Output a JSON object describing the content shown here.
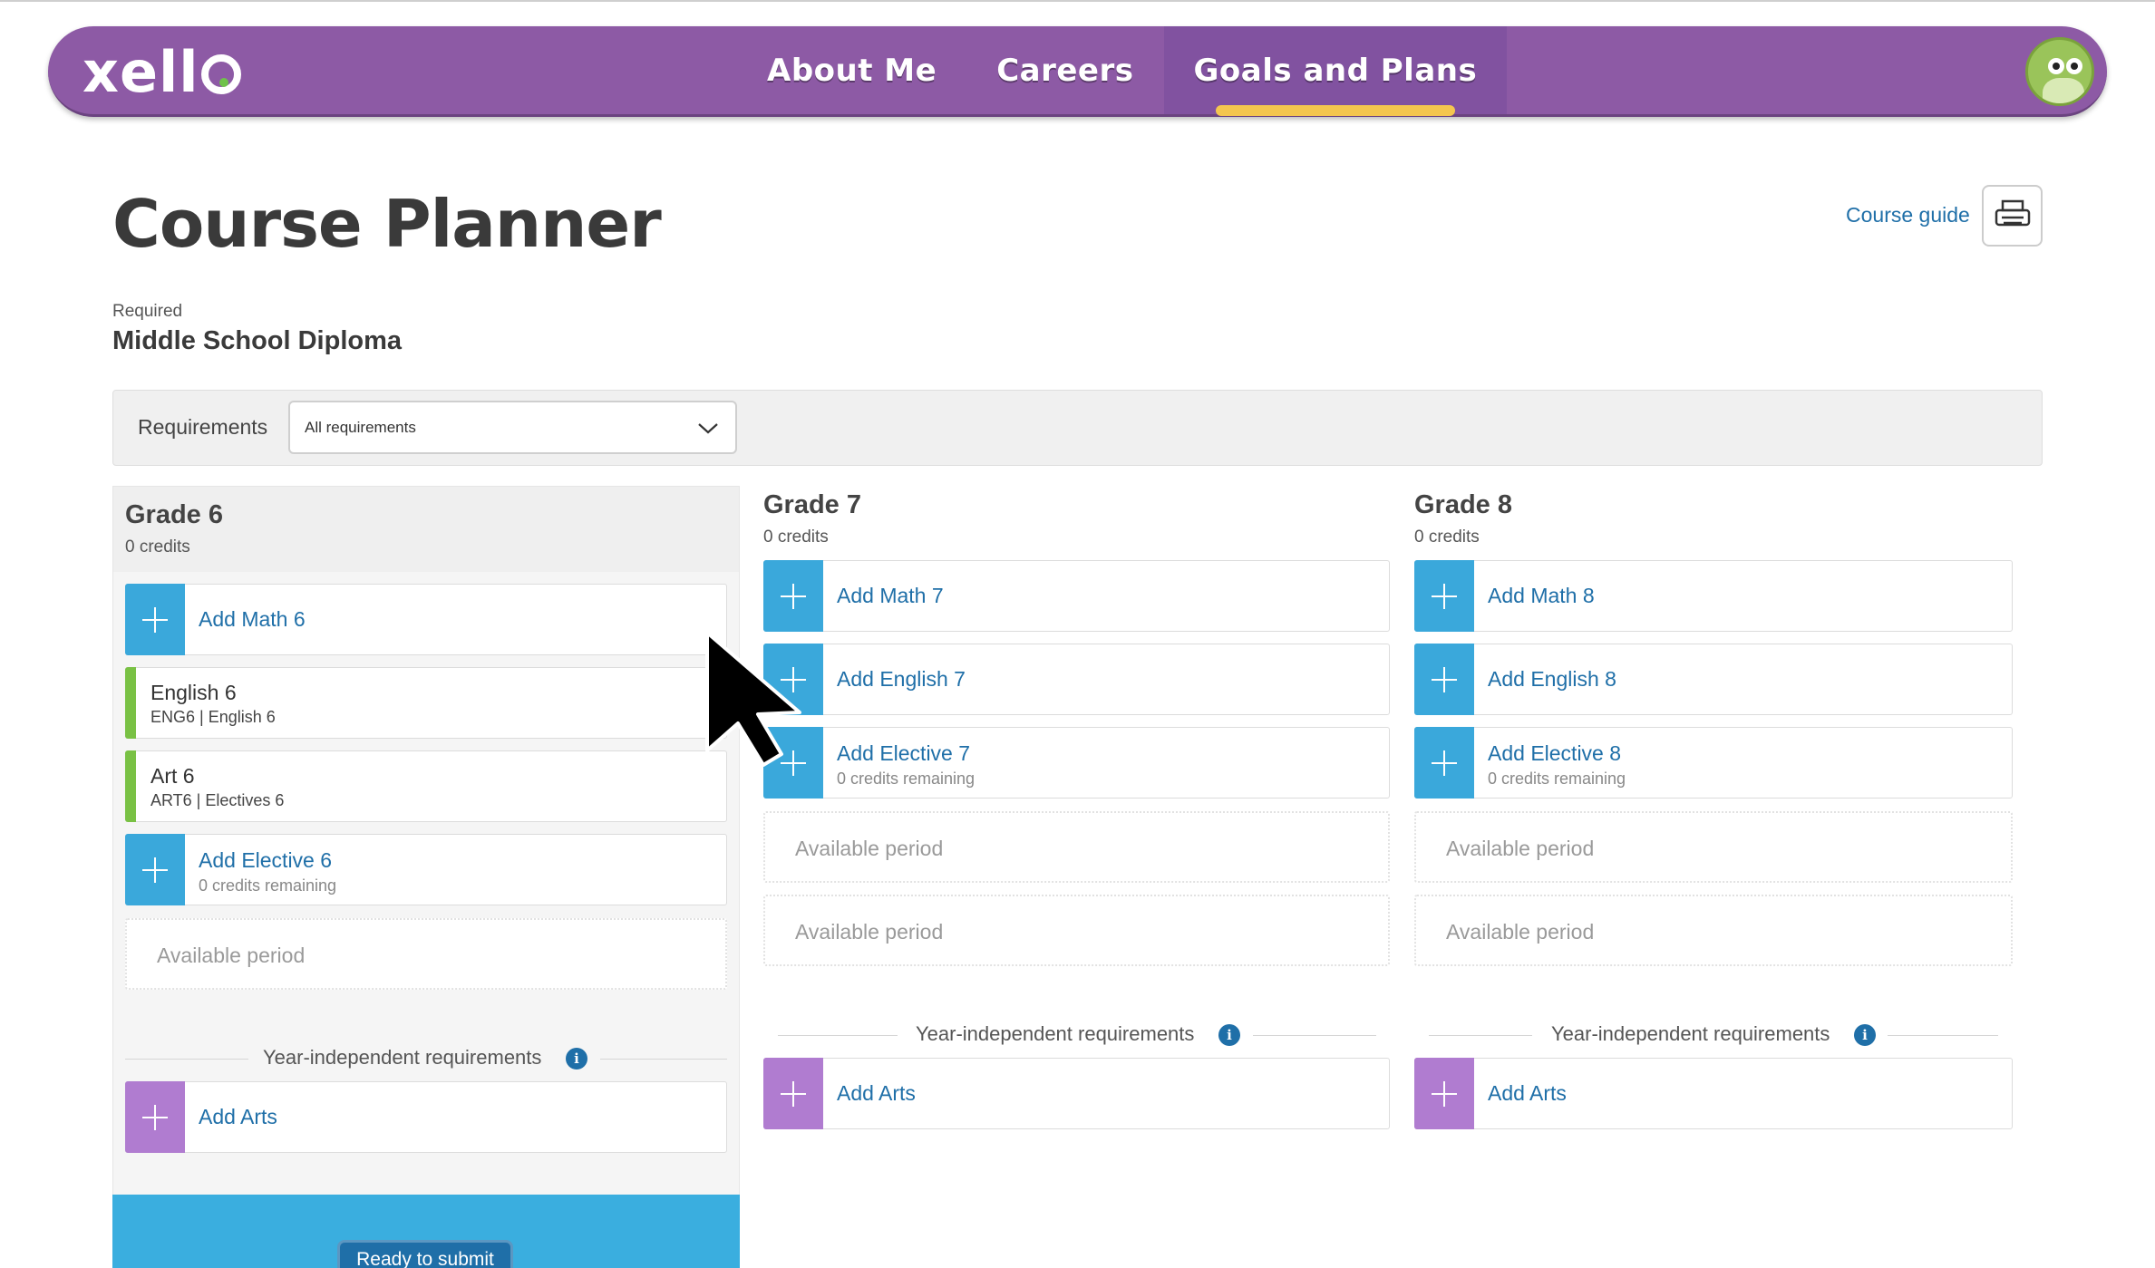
{
  "header": {
    "logo": "xello",
    "nav": [
      {
        "label": "About Me",
        "active": false
      },
      {
        "label": "Careers",
        "active": false
      },
      {
        "label": "Goals and Plans",
        "active": true
      }
    ]
  },
  "page": {
    "title": "Course Planner",
    "course_guide": "Course guide",
    "required_label": "Required",
    "diploma": "Middle School Diploma"
  },
  "filter": {
    "label": "Requirements",
    "selected": "All requirements"
  },
  "grades": [
    {
      "title": "Grade 6",
      "credits": "0 credits",
      "add_math": "Add Math 6",
      "course1": {
        "name": "English 6",
        "code": "ENG6 | English 6"
      },
      "course2": {
        "name": "Art 6",
        "code": "ART6 | Electives 6"
      },
      "add_elective": "Add Elective 6",
      "elective_sub": "0 credits remaining",
      "available": "Available period",
      "year_independent": "Year-independent requirements",
      "add_arts": "Add Arts"
    },
    {
      "title": "Grade 7",
      "credits": "0 credits",
      "add_math": "Add Math 7",
      "add_english": "Add English 7",
      "add_elective": "Add Elective 7",
      "elective_sub": "0 credits remaining",
      "available1": "Available period",
      "available2": "Available period",
      "year_independent": "Year-independent requirements",
      "add_arts": "Add Arts"
    },
    {
      "title": "Grade 8",
      "credits": "0 credits",
      "add_math": "Add Math 8",
      "add_english": "Add English 8",
      "add_elective": "Add Elective 8",
      "elective_sub": "0 credits remaining",
      "available1": "Available period",
      "available2": "Available period",
      "year_independent": "Year-independent requirements",
      "add_arts": "Add Arts"
    }
  ],
  "submit": {
    "label": "Ready to submit"
  },
  "colors": {
    "brand_purple": "#8d5aa5",
    "accent_blue": "#3aa8db",
    "link_blue": "#1f6fa8",
    "arts_purple": "#b07cd0",
    "course_green": "#79c144",
    "active_underline": "#f4c64f"
  },
  "icons": {
    "print": "printer-icon",
    "dropdown": "chevron-down-icon",
    "add": "plus-icon",
    "info": "info-icon",
    "cursor": "mouse-pointer-icon"
  }
}
